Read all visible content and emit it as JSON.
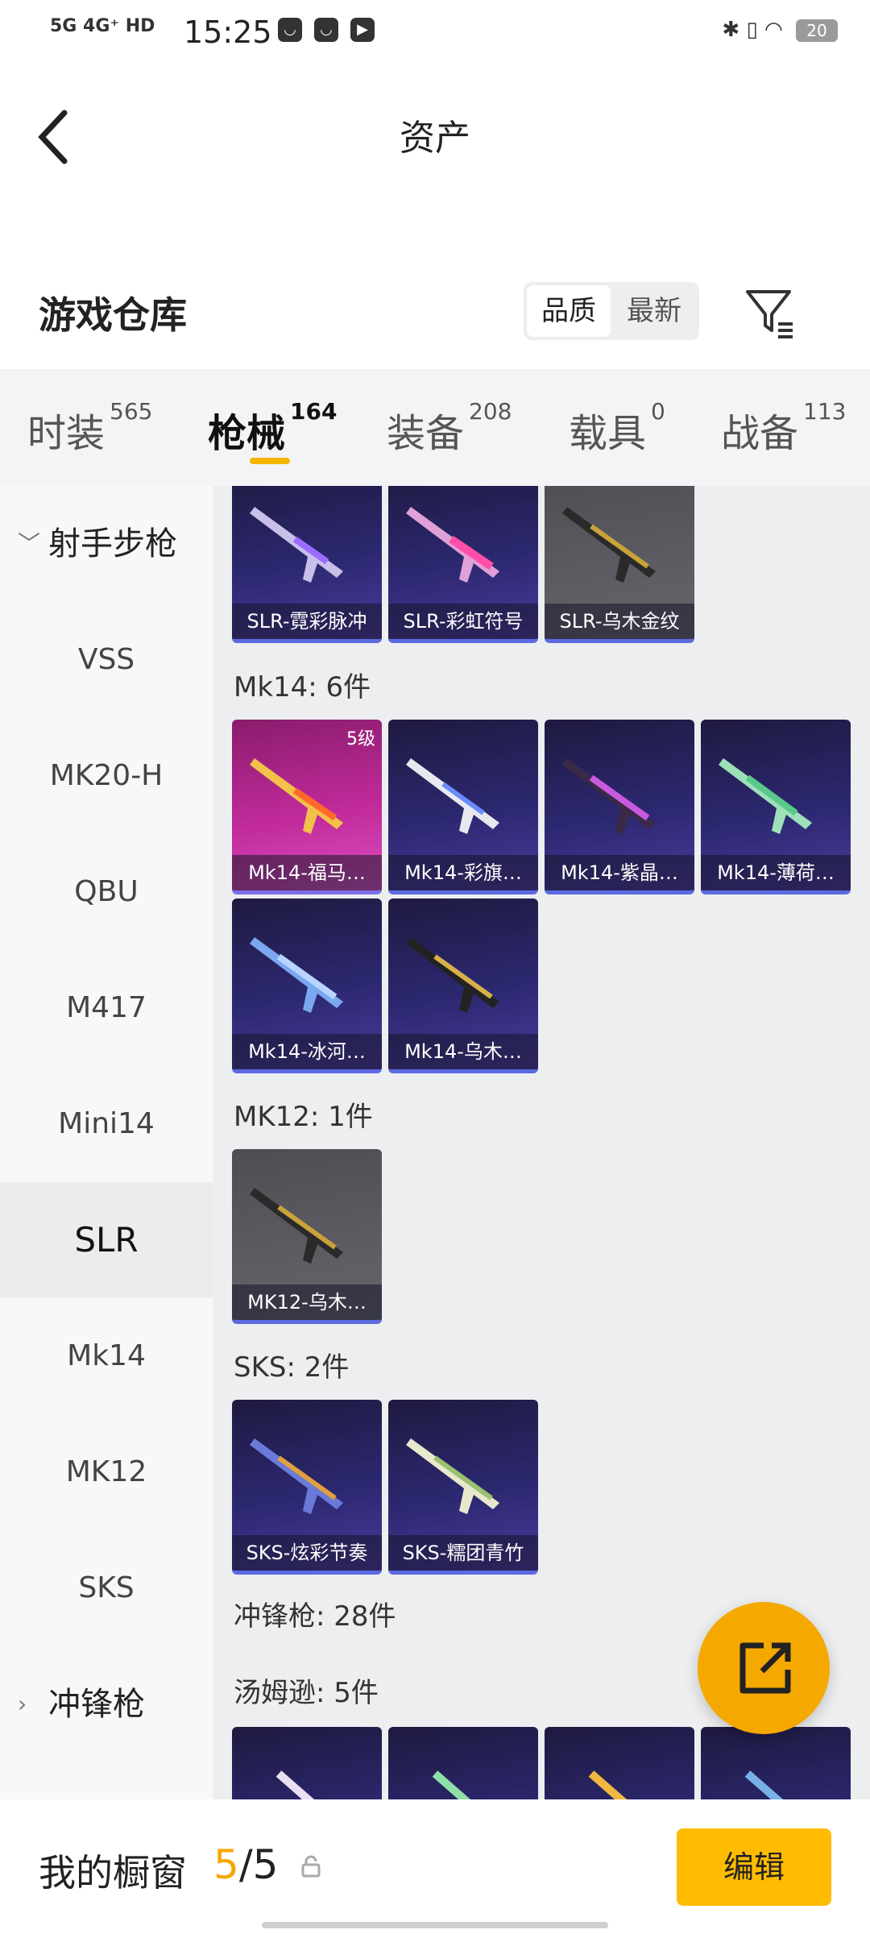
{
  "status": {
    "signal_1": "5G",
    "signal_2": "4G⁺",
    "hd": "HD",
    "time": "15:25",
    "battery": "20"
  },
  "header": {
    "title": "资产"
  },
  "warehouse": {
    "title": "游戏仓库",
    "sort_quality": "品质",
    "sort_newest": "最新"
  },
  "tabs": [
    {
      "label": "时装",
      "count": "565"
    },
    {
      "label": "枪械",
      "count": "164",
      "active": true
    },
    {
      "label": "装备",
      "count": "208"
    },
    {
      "label": "载具",
      "count": "0"
    },
    {
      "label": "战备",
      "count": "113"
    }
  ],
  "sidebar": {
    "group_marksman": "射手步枪",
    "items": [
      "VSS",
      "MK20-H",
      "QBU",
      "M417",
      "Mini14",
      "SLR",
      "Mk14",
      "MK12",
      "SKS"
    ],
    "selected": "SLR",
    "group_smg": "冲锋枪"
  },
  "content": {
    "slr_cards": [
      "SLR-霓彩脉冲",
      "SLR-彩虹符号",
      "SLR-乌木金纹"
    ],
    "mk14_title": "Mk14: 6件",
    "mk14_cards": [
      "Mk14-福马…",
      "Mk14-彩旗…",
      "Mk14-紫晶…",
      "Mk14-薄荷…",
      "Mk14-冰河…",
      "Mk14-乌木…"
    ],
    "mk14_level": "5级",
    "mk12_title": "MK12: 1件",
    "mk12_cards": [
      "MK12-乌木…"
    ],
    "sks_title": "SKS: 2件",
    "sks_cards": [
      "SKS-炫彩节奏",
      "SKS-糯团青竹"
    ],
    "smg_title": "冲锋枪: 28件",
    "thompson_title": "汤姆逊: 5件"
  },
  "bottom": {
    "window_label": "我的橱窗",
    "window_current": "5",
    "window_total": "/5",
    "edit": "编辑"
  },
  "colors": {
    "accent": "#f5a800",
    "button": "#ffbb00",
    "card_purple": "#2c2870",
    "card_pink": "#c02a9a",
    "card_grey": "#5c5c62"
  }
}
